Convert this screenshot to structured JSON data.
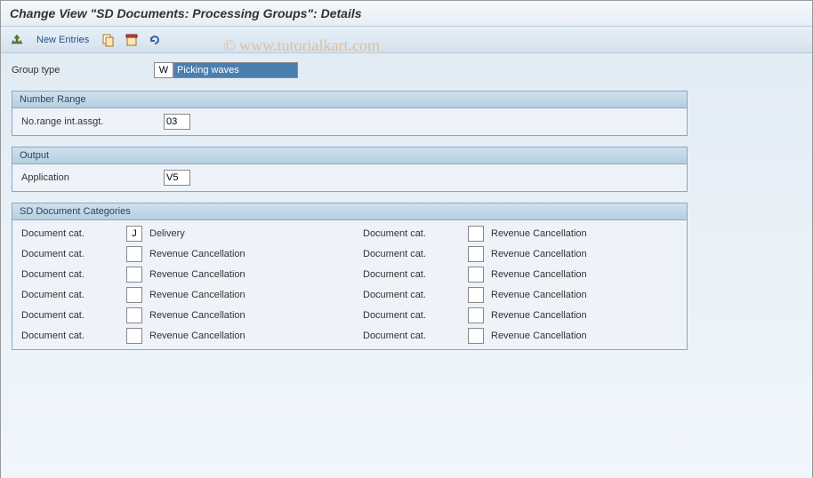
{
  "title": "Change View \"SD Documents: Processing Groups\": Details",
  "watermark": "© www.tutorialkart.com",
  "toolbar": {
    "new_entries_label": "New Entries"
  },
  "group_type": {
    "label": "Group type",
    "code": "W",
    "desc": "Picking waves"
  },
  "number_range": {
    "title": "Number Range",
    "field_label": "No.range int.assgt.",
    "value": "03"
  },
  "output": {
    "title": "Output",
    "field_label": "Application",
    "value": "V5"
  },
  "doc_categories": {
    "title": "SD Document Categories",
    "field_label": "Document cat.",
    "rows": [
      {
        "l_code": "J",
        "l_desc": "Delivery",
        "r_code": "",
        "r_desc": "Revenue Cancellation"
      },
      {
        "l_code": "",
        "l_desc": "Revenue Cancellation",
        "r_code": "",
        "r_desc": "Revenue Cancellation"
      },
      {
        "l_code": "",
        "l_desc": "Revenue Cancellation",
        "r_code": "",
        "r_desc": "Revenue Cancellation"
      },
      {
        "l_code": "",
        "l_desc": "Revenue Cancellation",
        "r_code": "",
        "r_desc": "Revenue Cancellation"
      },
      {
        "l_code": "",
        "l_desc": "Revenue Cancellation",
        "r_code": "",
        "r_desc": "Revenue Cancellation"
      },
      {
        "l_code": "",
        "l_desc": "Revenue Cancellation",
        "r_code": "",
        "r_desc": "Revenue Cancellation"
      }
    ]
  }
}
